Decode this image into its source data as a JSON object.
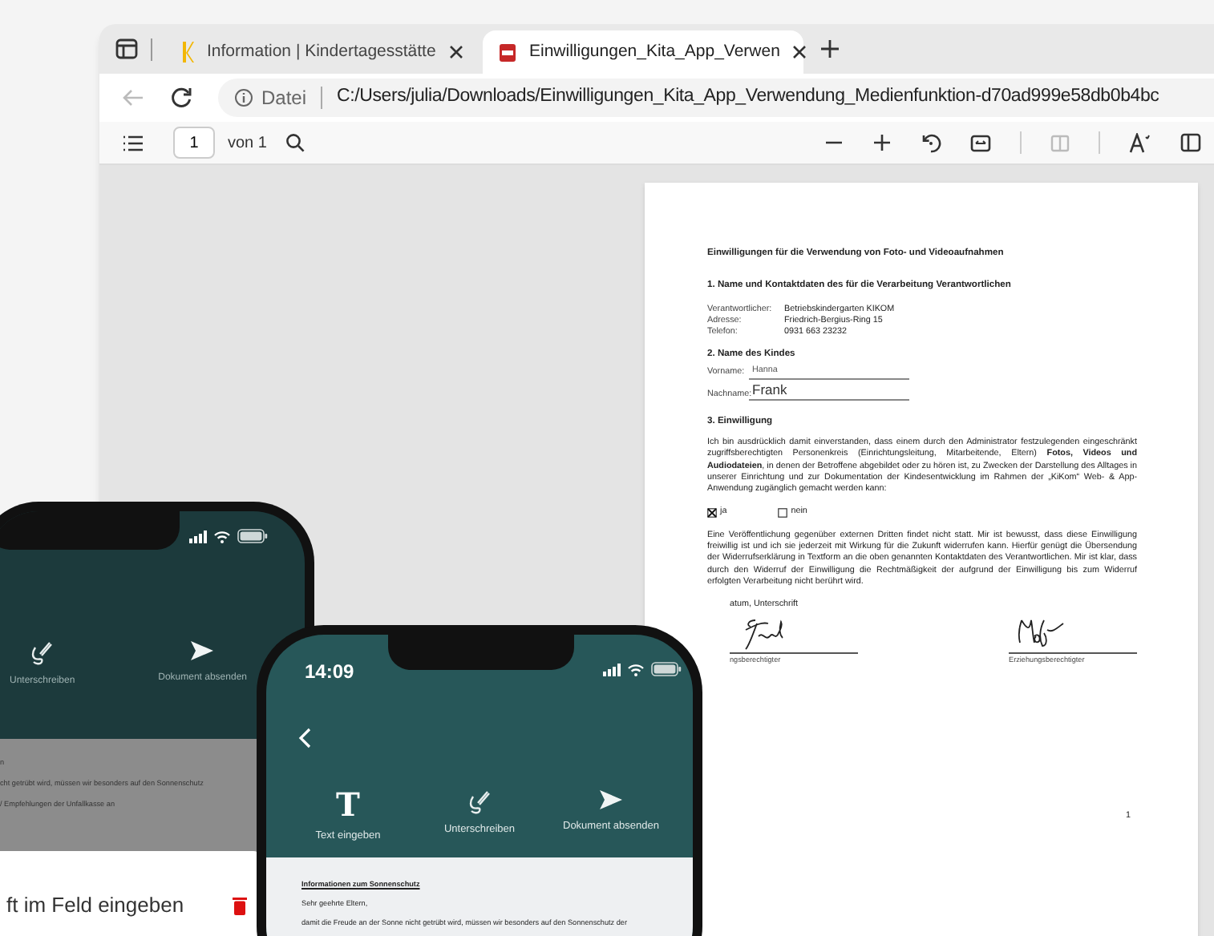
{
  "browser": {
    "tabs": [
      {
        "title": "Information | Kindertagesstätte",
        "kind": "site",
        "selected": false
      },
      {
        "title": "Einwilligungen_Kita_App_Verwen",
        "kind": "pdf",
        "selected": true
      }
    ],
    "address": {
      "label": "Datei",
      "path": "C:/Users/julia/Downloads/Einwilligungen_Kita_App_Verwendung_Medienfunktion-d70ad999e58db0b4bc"
    },
    "pdf_toolbar": {
      "page": "1",
      "page_count": "von 1"
    }
  },
  "document": {
    "title": "Einwilligungen für die Verwendung von Foto- und Videoaufnahmen",
    "section_1": {
      "heading": "1. Name und Kontaktdaten des für die Verarbeitung Verantwortlichen",
      "rows": [
        {
          "label": "Verantwortlicher:",
          "value": "Betriebskindergarten KIKOM"
        },
        {
          "label": "Adresse:",
          "value": "Friedrich-Bergius-Ring 15"
        },
        {
          "label": "Telefon:",
          "value": "0931 663 23232"
        }
      ]
    },
    "section_2": {
      "heading": "2. Name des Kindes",
      "fields": [
        {
          "label": "Vorname:",
          "value": "Hanna",
          "kind": "small"
        },
        {
          "label": "Nachname:",
          "value": "Frank",
          "kind": "large"
        }
      ]
    },
    "section_3": {
      "heading": "3. Einwilligung",
      "text": "Ich bin ausdrücklich damit einverstanden, dass einem durch den Administrator festzulegenden eingeschränkt zugriffsberechtigten Personenkreis (Einrichtungsleitung, Mitarbeitende, Eltern) **Fotos, Videos und Audiodateien**, in denen der Betroffene abgebildet oder zu hören ist, zu Zwecken der Darstellung des Alltages in unserer Einrichtung und zur Dokumentation der Kindesentwicklung im Rahmen der „KiKom“ Web- & App-Anwendung zugänglich gemacht werden kann:",
      "options": [
        {
          "label": "ja",
          "checked": true
        },
        {
          "label": "nein",
          "checked": false
        }
      ],
      "text_2": "Eine Veröffentlichung gegenüber externen Dritten findet nicht statt. Mir ist bewusst, dass diese Einwilligung freiwillig ist und ich sie jederzeit mit Wirkung für die Zukunft widerrufen kann. Hierfür genügt die Übersendung der Widerrufserklärung in Textform an die oben genannten Kontaktdaten des Verantwortlichen. Mir ist klar, dass durch den Widerruf der Einwilligung die Rechtmäßigkeit der aufgrund der Einwilligung bis zum Widerruf erfolgten Verarbeitung nicht berührt wird.",
      "signature_label": "atum, Unterschrift",
      "signatures": [
        {
          "caption": "ngsberechtigter"
        },
        {
          "caption": "Erziehungsberechtigter"
        }
      ]
    },
    "page_number": "1"
  },
  "phone_back": {
    "toolbar": [
      {
        "kind": "sign",
        "label": "Unterschreiben"
      },
      {
        "kind": "send",
        "label": "Dokument absenden"
      }
    ],
    "lines": [
      "n",
      "cht getrübt wird, müssen wir besonders auf den Sonnenschutz",
      "/ Empfehlungen der Unfallkasse an"
    ],
    "dialog_title": "ft im Feld eingeben"
  },
  "phone_front": {
    "time": "14:09",
    "toolbar": [
      {
        "kind": "text",
        "icon_char": "T",
        "label": "Text eingeben"
      },
      {
        "kind": "sign",
        "label": "Unterschreiben"
      },
      {
        "kind": "send",
        "label": "Dokument absenden"
      }
    ],
    "heading": "Informationen zum Sonnenschutz",
    "greeting": "Sehr geehrte Eltern,",
    "text": "damit die Freude an der Sonne nicht getrübt wird, müssen wir besonders auf den Sonnenschutz der"
  }
}
